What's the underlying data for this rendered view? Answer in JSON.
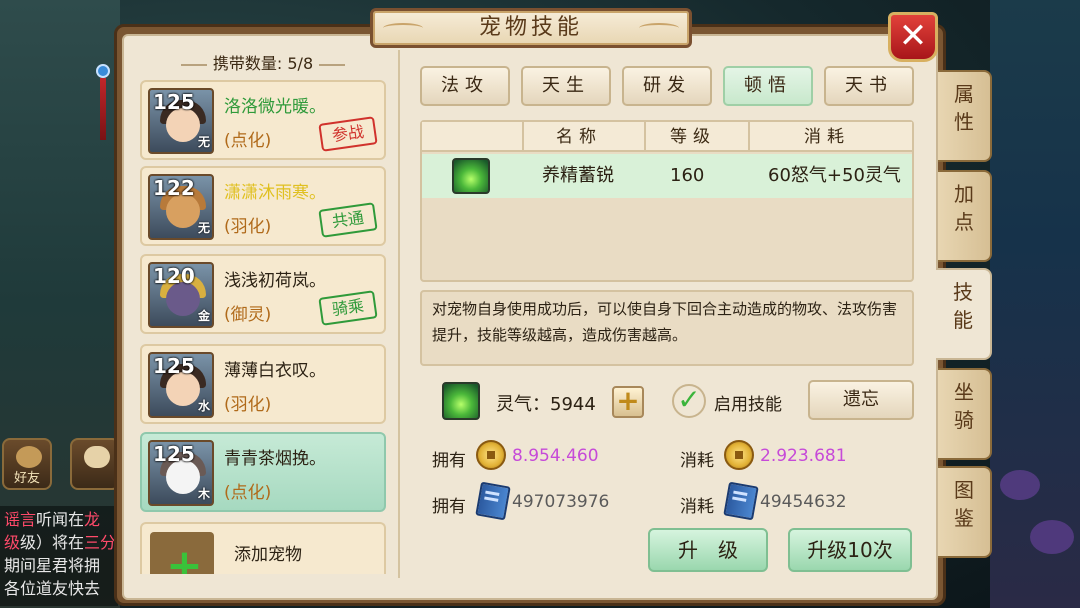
{
  "window": {
    "title": "宠物技能",
    "close_label": "✕"
  },
  "chat": {
    "friend_label": "好友",
    "lines": [
      {
        "tag": "谣言",
        "text": "听闻在",
        "red": "龙"
      },
      {
        "text": "级）将在",
        "red": "三分",
        "prefix_red": "级"
      },
      {
        "text": "期间星君将拥"
      },
      {
        "text": "各位道友快去"
      }
    ]
  },
  "carry": {
    "label": "携带数量:",
    "value": "5/8"
  },
  "pets": [
    {
      "level": "125",
      "element": "无",
      "name": "洛洛微光暖。",
      "type": "(点化)",
      "stamp": "参战",
      "stamp_color": "#d0322c",
      "name_color": "#2f9a3a",
      "selected": false
    },
    {
      "level": "122",
      "element": "无",
      "name": "潇潇沐雨寒。",
      "type": "(羽化)",
      "stamp": "共通",
      "stamp_color": "#2f9a3a",
      "name_color": "#e0c020",
      "selected": false
    },
    {
      "level": "120",
      "element": "金",
      "name": "浅浅初荷岚。",
      "type": "(御灵)",
      "stamp": "骑乘",
      "stamp_color": "#2f9a3a",
      "name_color": "#2c2214",
      "selected": false
    },
    {
      "level": "125",
      "element": "水",
      "name": "薄薄白衣叹。",
      "type": "(羽化)",
      "stamp": "",
      "name_color": "#2c2214",
      "selected": false
    },
    {
      "level": "125",
      "element": "木",
      "name": "青青茶烟挽。",
      "type": "(点化)",
      "stamp": "",
      "name_color": "#2c2214",
      "selected": true
    }
  ],
  "add_pet_label": "添加宠物",
  "skill_tabs": [
    {
      "label": "法攻",
      "active": false
    },
    {
      "label": "天生",
      "active": false
    },
    {
      "label": "研发",
      "active": false
    },
    {
      "label": "顿悟",
      "active": true
    },
    {
      "label": "天书",
      "active": false
    }
  ],
  "skill_table": {
    "headers": [
      "名称",
      "等级",
      "消耗"
    ],
    "rows": [
      {
        "name": "养精蓄锐",
        "level": "160",
        "cost": "60怒气+50灵气"
      }
    ]
  },
  "description": "对宠物自身使用成功后，可以使自身下回合主动造成的物攻、法攻伤害提升，技能等级越高，造成伤害越高。",
  "lingqi": {
    "label": "灵气：5944"
  },
  "enable_label": "启用技能",
  "forget_label": "遗忘",
  "resources": {
    "own_label": "拥有",
    "cost_label": "消耗",
    "coin_own": "8.954.460",
    "coin_cost": "2.923.681",
    "book_own": "497073976",
    "book_cost": "49454632"
  },
  "upgrade_label": "升　级",
  "upgrade10_label": "升级10次",
  "side_tabs": [
    {
      "label": [
        "属",
        "性"
      ],
      "active": false
    },
    {
      "label": [
        "加",
        "点"
      ],
      "active": false
    },
    {
      "label": [
        "技",
        "能"
      ],
      "active": true
    },
    {
      "label": [
        "坐",
        "骑"
      ],
      "active": false
    },
    {
      "label": [
        "图",
        "鉴"
      ],
      "active": false
    }
  ],
  "colors": {
    "accent_green": "#9ad7ae",
    "frame": "#7a5632",
    "panel": "#efe6d4",
    "purple_value": "#c64ad8"
  }
}
